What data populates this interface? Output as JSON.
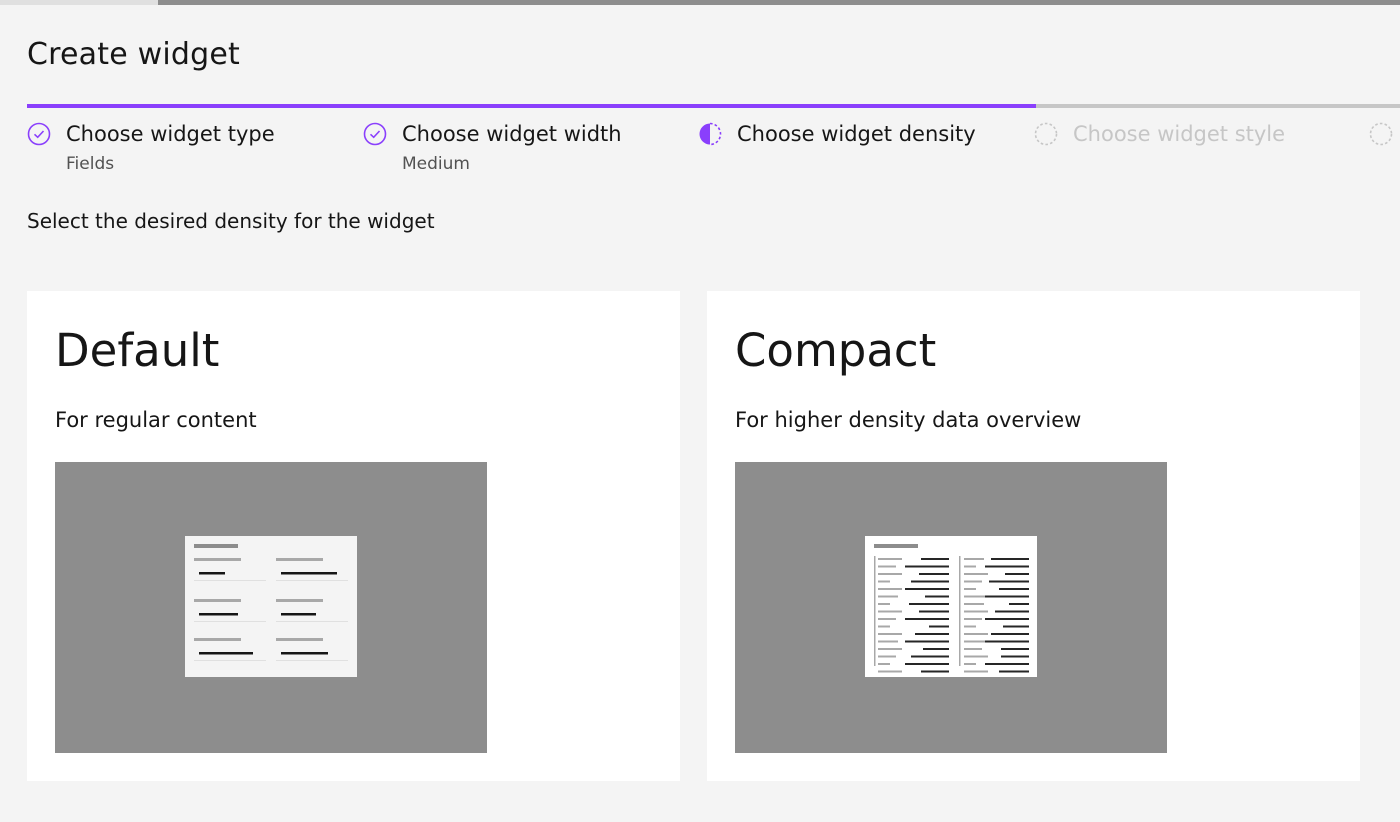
{
  "header": {
    "title": "Create widget"
  },
  "progress": {
    "fraction": 0.735
  },
  "steps": [
    {
      "label": "Choose widget type",
      "sub": "Fields",
      "state": "complete"
    },
    {
      "label": "Choose widget width",
      "sub": "Medium",
      "state": "complete"
    },
    {
      "label": "Choose widget density",
      "sub": "",
      "state": "current"
    },
    {
      "label": "Choose widget style",
      "sub": "",
      "state": "incomplete"
    },
    {
      "label": "",
      "sub": "",
      "state": "incomplete"
    }
  ],
  "instruction": "Select the desired density for the widget",
  "options": [
    {
      "title": "Default",
      "description": "For regular content",
      "preview": "default-density-illustration"
    },
    {
      "title": "Compact",
      "description": "For higher density data overview",
      "preview": "compact-density-illustration"
    }
  ],
  "colors": {
    "accent": "#8a3ffc",
    "background": "#f4f4f4",
    "card": "#ffffff",
    "preview": "#8d8d8d"
  }
}
